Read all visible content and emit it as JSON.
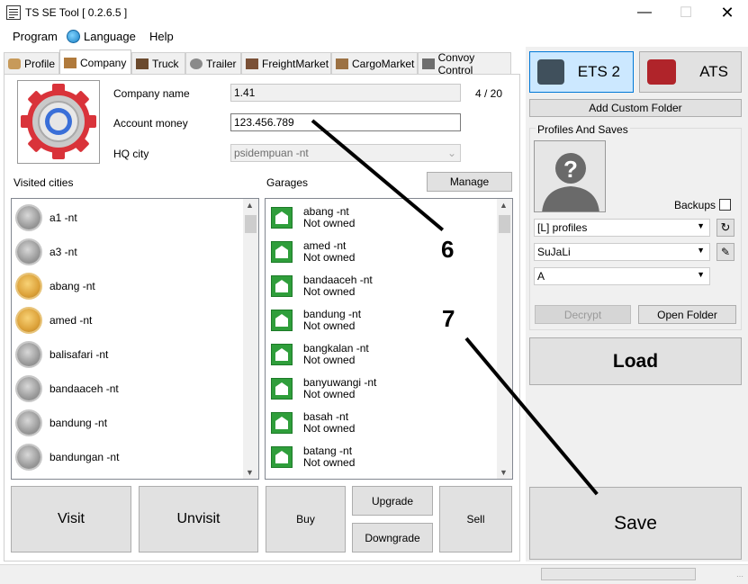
{
  "window": {
    "title": "TS SE Tool [ 0.2.6.5 ]"
  },
  "menu": [
    "Program",
    "Language",
    "Help"
  ],
  "tabs": [
    {
      "label": "Profile",
      "icon": "profile-icon"
    },
    {
      "label": "Company",
      "icon": "company-icon"
    },
    {
      "label": "Truck",
      "icon": "truck-icon"
    },
    {
      "label": "Trailer",
      "icon": "trailer-icon"
    },
    {
      "label": "FreightMarket",
      "icon": "freight-market-icon"
    },
    {
      "label": "CargoMarket",
      "icon": "cargo-market-icon"
    },
    {
      "label": "Convoy Control",
      "icon": "convoy-control-icon"
    }
  ],
  "company": {
    "name_label": "Company name",
    "name_value": "1.41",
    "name_count": "4 / 20",
    "money_label": "Account money",
    "money_value": "123.456.789",
    "hq_label": "HQ city",
    "hq_value": "psidempuan -nt"
  },
  "visited": {
    "label": "Visited cities",
    "items": [
      {
        "name": "a1 -nt",
        "visited": false
      },
      {
        "name": "a3 -nt",
        "visited": false
      },
      {
        "name": "abang -nt",
        "visited": true
      },
      {
        "name": "amed -nt",
        "visited": true
      },
      {
        "name": "balisafari -nt",
        "visited": false
      },
      {
        "name": "bandaaceh -nt",
        "visited": false
      },
      {
        "name": "bandung -nt",
        "visited": false
      },
      {
        "name": "bandungan -nt",
        "visited": false
      }
    ]
  },
  "garages": {
    "label": "Garages",
    "manage": "Manage",
    "items": [
      {
        "name": "abang -nt",
        "status": "Not owned"
      },
      {
        "name": "amed -nt",
        "status": "Not owned"
      },
      {
        "name": "bandaaceh -nt",
        "status": "Not owned"
      },
      {
        "name": "bandung -nt",
        "status": "Not owned"
      },
      {
        "name": "bangkalan -nt",
        "status": "Not owned"
      },
      {
        "name": "banyuwangi -nt",
        "status": "Not owned"
      },
      {
        "name": "basah -nt",
        "status": "Not owned"
      },
      {
        "name": "batang -nt",
        "status": "Not owned"
      }
    ]
  },
  "buttons": {
    "visit": "Visit",
    "unvisit": "Unvisit",
    "buy": "Buy",
    "upgrade": "Upgrade",
    "downgrade": "Downgrade",
    "sell": "Sell"
  },
  "right": {
    "ets2": "ETS 2",
    "ats": "ATS",
    "add_folder": "Add Custom Folder",
    "profiles_label": "Profiles And Saves",
    "backups": "Backups",
    "profile_folder": "[L] profiles",
    "profile": "SuJaLi",
    "save": "A",
    "decrypt": "Decrypt",
    "open_folder": "Open Folder",
    "load": "Load",
    "save_btn": "Save"
  },
  "annotations": {
    "six": "6",
    "seven": "7"
  }
}
